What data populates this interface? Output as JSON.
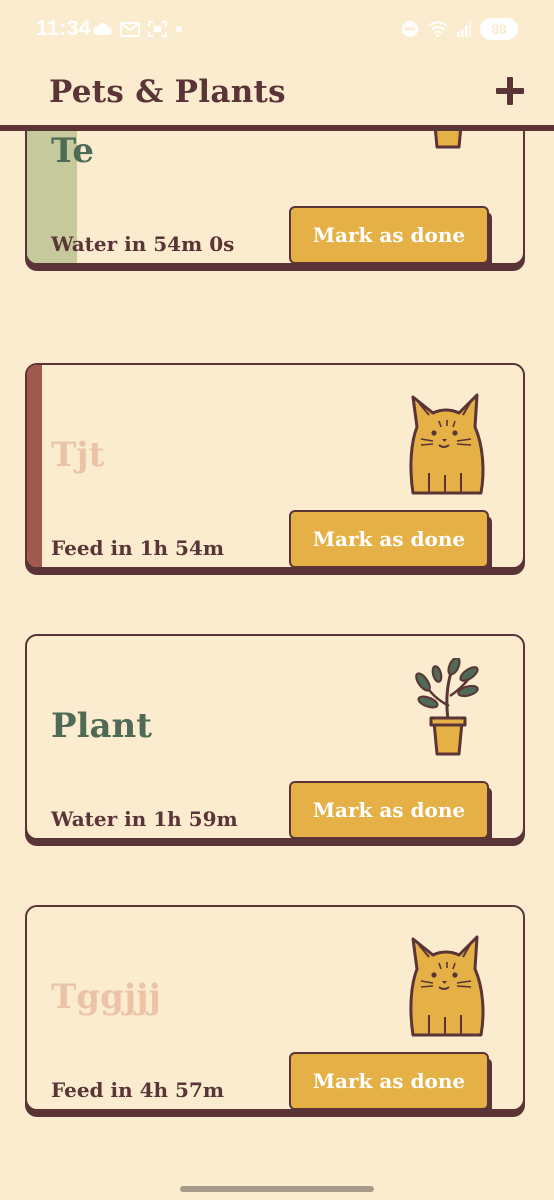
{
  "status_bar": {
    "time": "11:34",
    "battery": "88"
  },
  "header": {
    "title": "Pets & Plants",
    "add_icon": "plus-icon"
  },
  "cards": [
    {
      "name": "Te",
      "kind": "plant",
      "status": "Water in 54m 0s",
      "button_label": "Mark as done",
      "name_color": "#4f6b55",
      "bar_color": "#c5c99b",
      "bar_progress": 0.1,
      "illustration": "potted-plant-icon"
    },
    {
      "name": "Tjt",
      "kind": "pet",
      "status": "Feed in 1h 54m",
      "button_label": "Mark as done",
      "name_color": "#ebc3a6",
      "bar_color": "#a1594f",
      "bar_progress": 0.03,
      "illustration": "cat-icon"
    },
    {
      "name": "Plant",
      "kind": "plant",
      "status": "Water in 1h 59m",
      "button_label": "Mark as done",
      "name_color": "#4f6b55",
      "bar_color": "#c5c99b",
      "bar_progress": 0,
      "illustration": "potted-plant-icon"
    },
    {
      "name": "Tggjjj",
      "kind": "pet",
      "status": "Feed in 4h 57m",
      "button_label": "Mark as done",
      "name_color": "#ebc3a6",
      "bar_color": "#a1594f",
      "bar_progress": 0,
      "illustration": "cat-icon"
    }
  ]
}
